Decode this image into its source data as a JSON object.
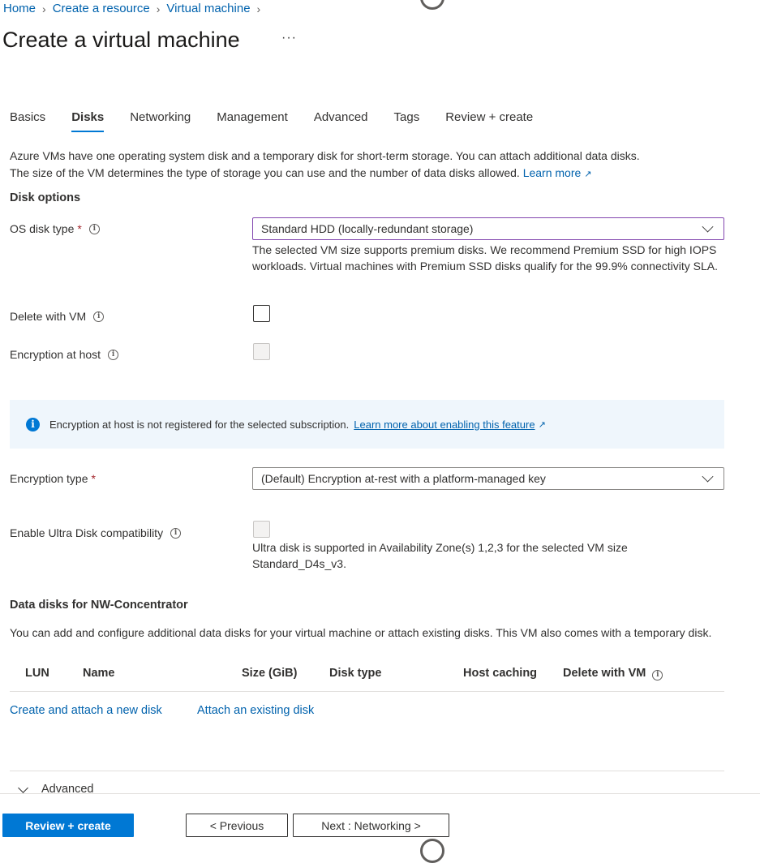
{
  "breadcrumb": [
    "Home",
    "Create a resource",
    "Virtual machine"
  ],
  "page_title": "Create a virtual machine",
  "more_label": "···",
  "tabs": [
    "Basics",
    "Disks",
    "Networking",
    "Management",
    "Advanced",
    "Tags",
    "Review + create"
  ],
  "active_tab": "Disks",
  "intro": {
    "text1": "Azure VMs have one operating system disk and a temporary disk for short-term storage. You can attach additional data disks.",
    "text2": "The size of the VM determines the type of storage you can use and the number of data disks allowed.",
    "learn_more": "Learn more"
  },
  "disk_options": {
    "heading": "Disk options",
    "os_disk_type": {
      "label": "OS disk type",
      "required_mark": "*",
      "value": "Standard HDD (locally-redundant storage)",
      "help": "The selected VM size supports premium disks. We recommend Premium SSD for high IOPS workloads. Virtual machines with Premium SSD disks qualify for the 99.9% connectivity SLA."
    },
    "delete_with_vm": {
      "label": "Delete with VM",
      "checked": false
    },
    "encryption_at_host": {
      "label": "Encryption at host",
      "checked": false,
      "disabled": true
    },
    "banner": {
      "text": "Encryption at host is not registered for the selected subscription.",
      "link": "Learn more about enabling this feature"
    },
    "encryption_type": {
      "label": "Encryption type",
      "required_mark": "*",
      "value": "(Default) Encryption at-rest with a platform-managed key"
    },
    "ultra_disk": {
      "label": "Enable Ultra Disk compatibility",
      "checked": false,
      "disabled": true,
      "help": "Ultra disk is supported in Availability Zone(s) 1,2,3 for the selected VM size Standard_D4s_v3."
    }
  },
  "data_disks": {
    "heading": "Data disks for NW-Concentrator",
    "description": "You can add and configure additional data disks for your virtual machine or attach existing disks. This VM also comes with a temporary disk.",
    "columns": [
      "LUN",
      "Name",
      "Size (GiB)",
      "Disk type",
      "Host caching",
      "Delete with VM"
    ],
    "create_link": "Create and attach a new disk",
    "attach_link": "Attach an existing disk"
  },
  "advanced_section": {
    "label": "Advanced"
  },
  "footer": {
    "review_create": "Review + create",
    "previous": "< Previous",
    "next": "Next : Networking >"
  },
  "colors": {
    "accent": "#0078d4",
    "link": "#0062ad",
    "required": "#a4262c",
    "banner_bg": "#eff6fc",
    "focus_border": "#8246af"
  },
  "icons": [
    "info-icon",
    "external-link-icon",
    "chevron-down-icon",
    "chevron-right-icon"
  ]
}
